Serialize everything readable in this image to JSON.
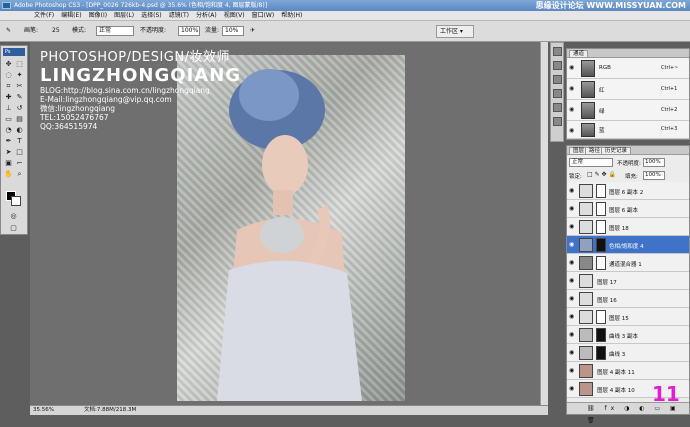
{
  "titlebar": {
    "title": "Adobe Photoshop CS3 - [DPP_0026 726kb-4.psd @ 35.6% (色相/饱和度 4, 图层蒙版/8)]",
    "watermark": "思缘设计论坛 WWW.MISSYUAN.COM"
  },
  "menu": [
    "文件(F)",
    "编辑(E)",
    "图像(I)",
    "图层(L)",
    "选择(S)",
    "滤镜(T)",
    "分析(A)",
    "视图(V)",
    "窗口(W)",
    "帮助(H)"
  ],
  "options": {
    "brush_label": "画笔:",
    "brush_size": "25",
    "mode_label": "模式:",
    "mode_value": "正常",
    "opacity_label": "不透明度:",
    "opacity_value": "100%",
    "flow_label": "流量:",
    "flow_value": "10%",
    "workspace": "工作区 ▾"
  },
  "toolbox": {
    "ps": "Ps"
  },
  "overlay": {
    "line1": "PHOTOSHOP/DESIGN/妆效师",
    "line2": "LINGZHONGQIANG",
    "blog": "BLOG:http://blog.sina.com.cn/lingzhongqiang",
    "email": "E-Mail:lingzhongqiang@vip.qq.com",
    "wechat": "微信:lingzhongqiang",
    "tel": "TEL:15052476767",
    "qq": "QQ:364515974"
  },
  "status": {
    "zoom": "35.56%",
    "doc": "文档:7.88M/218.3M"
  },
  "channels": {
    "tab": "通道",
    "rows": [
      {
        "name": "RGB",
        "shortcut": "Ctrl+~"
      },
      {
        "name": "红",
        "shortcut": "Ctrl+1"
      },
      {
        "name": "绿",
        "shortcut": "Ctrl+2"
      },
      {
        "name": "蓝",
        "shortcut": "Ctrl+3"
      }
    ]
  },
  "layers": {
    "tabs": [
      "图层",
      "路径",
      "历史记录"
    ],
    "blend_mode": "正常",
    "opacity_label": "不透明度:",
    "opacity": "100%",
    "lock_label": "锁定:",
    "fill_label": "填充:",
    "fill": "100%",
    "rows": [
      {
        "name": "图层 6 副本 2",
        "selected": false
      },
      {
        "name": "图层 6 副本",
        "selected": false
      },
      {
        "name": "图层 18",
        "selected": false
      },
      {
        "name": "色相/饱和度 4",
        "selected": true
      },
      {
        "name": "通道混合器 1",
        "selected": false
      },
      {
        "name": "图层 17",
        "selected": false
      },
      {
        "name": "图层 16",
        "selected": false
      },
      {
        "name": "图层 15",
        "selected": false
      },
      {
        "name": "曲线 3 副本",
        "selected": false
      },
      {
        "name": "曲线 3",
        "selected": false
      },
      {
        "name": "图层 4 副本 11",
        "selected": false
      },
      {
        "name": "图层 4 副本 10",
        "selected": false
      }
    ]
  },
  "page_number": "11"
}
